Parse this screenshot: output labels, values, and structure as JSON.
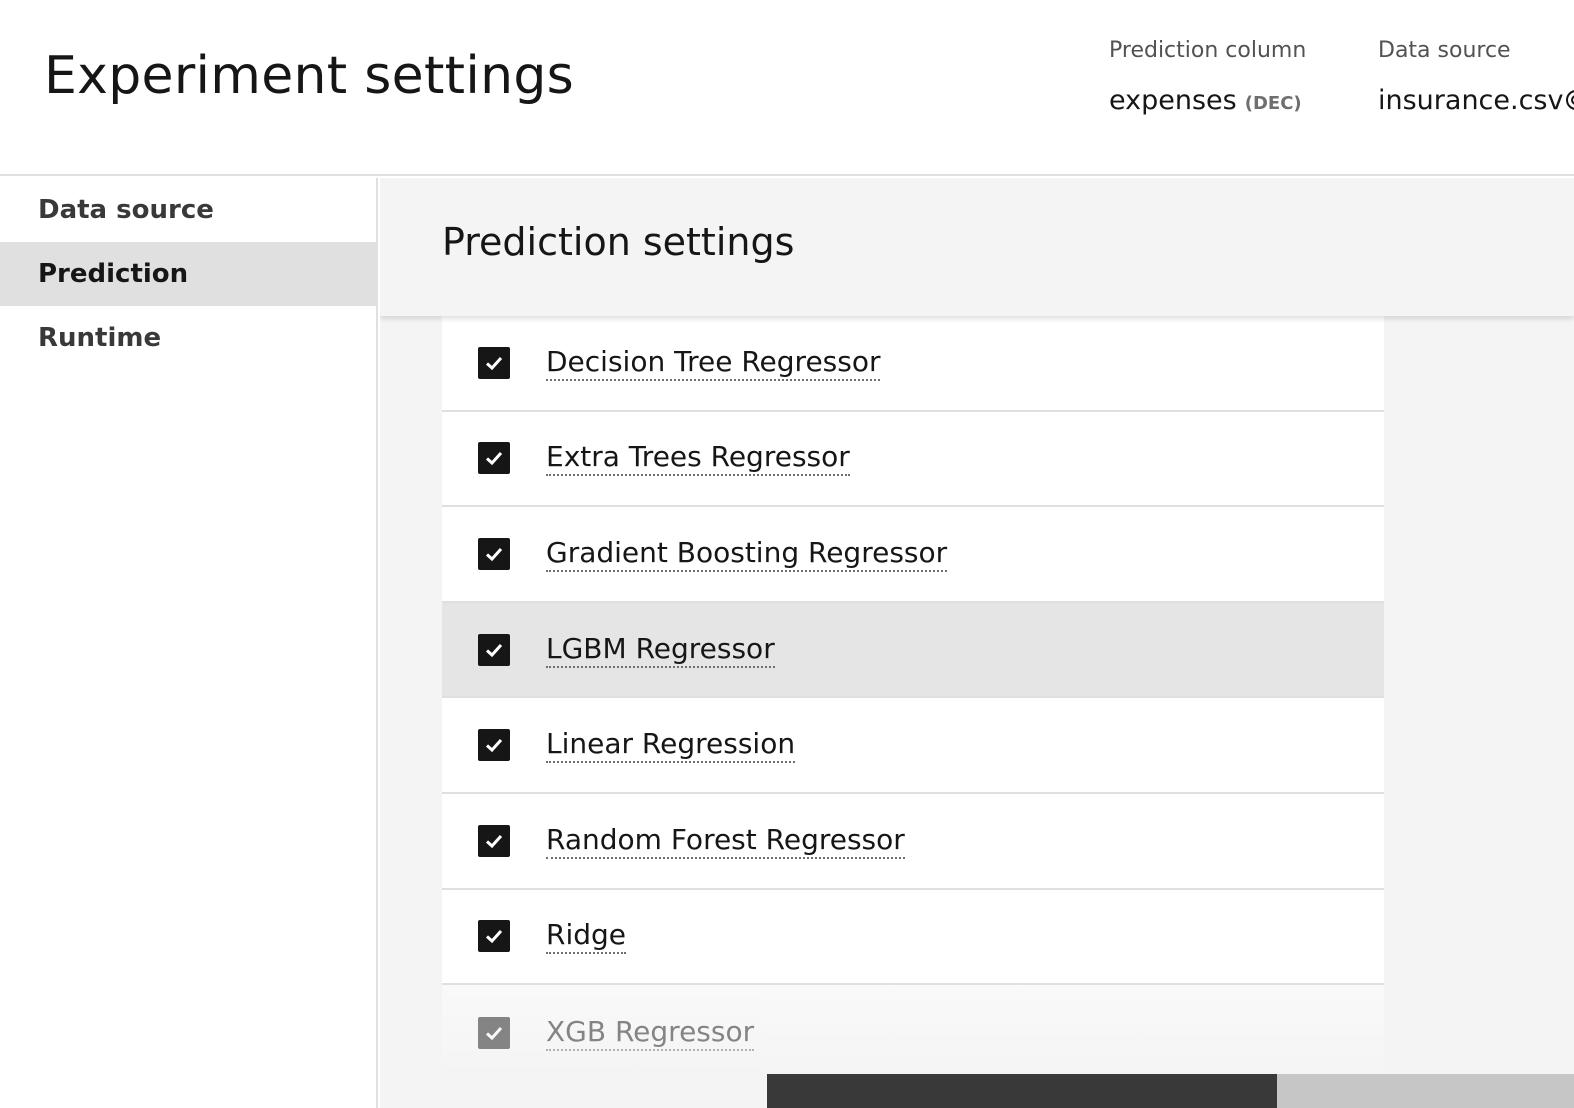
{
  "header": {
    "title": "Experiment settings",
    "prediction_column": {
      "label": "Prediction column",
      "value": "expenses",
      "type": "(DEC)"
    },
    "data_source": {
      "label": "Data source",
      "value": "insurance.csv"
    }
  },
  "sidebar": {
    "items": [
      {
        "label": "Data source"
      },
      {
        "label": "Prediction",
        "active": true
      },
      {
        "label": "Runtime"
      }
    ]
  },
  "main": {
    "section_title": "Prediction settings",
    "algorithms": [
      {
        "label": "Decision Tree Regressor",
        "checked": true
      },
      {
        "label": "Extra Trees Regressor",
        "checked": true
      },
      {
        "label": "Gradient Boosting Regressor",
        "checked": true
      },
      {
        "label": "LGBM Regressor",
        "checked": true
      },
      {
        "label": "Linear Regression",
        "checked": true
      },
      {
        "label": "Random Forest Regressor",
        "checked": true
      },
      {
        "label": "Ridge",
        "checked": true
      },
      {
        "label": "XGB Regressor",
        "checked": true
      }
    ]
  },
  "colors": {
    "accent": "#161616",
    "active_nav": "#e0e0e0",
    "hover_row": "#e5e5e5"
  },
  "icons": [
    "checkmark-icon",
    "view-icon"
  ]
}
